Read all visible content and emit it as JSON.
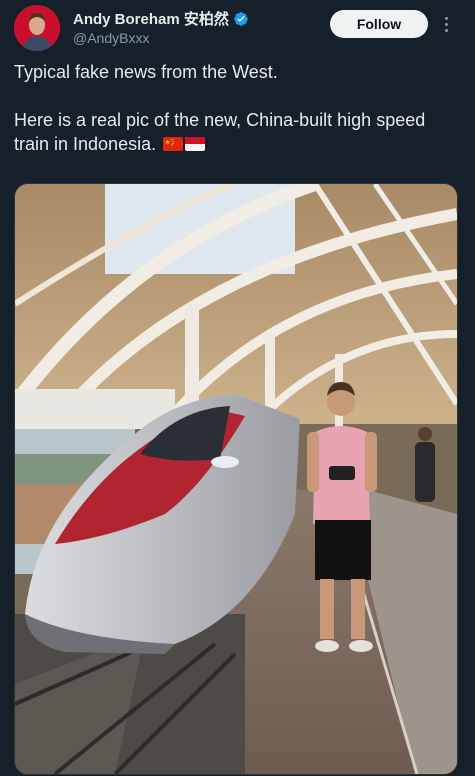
{
  "author": {
    "display_name": "Andy Boreham 安柏然",
    "handle": "@AndyBxxx",
    "verified": true,
    "avatar_bg": "#c8102e"
  },
  "actions": {
    "follow_label": "Follow",
    "more_icon": "more-icon"
  },
  "tweet": {
    "line1": "Typical fake news from the West.",
    "line2": "Here is a real pic of the new, China-built high speed train in Indonesia.",
    "emoji_flags": [
      "china-flag",
      "indonesia-flag"
    ]
  },
  "media": {
    "type": "photo",
    "subject": "high-speed-train-at-station"
  },
  "colors": {
    "background": "#15202b",
    "text": "#e7e9ea",
    "muted": "#8b98a5",
    "verified": "#1d9bf0"
  }
}
